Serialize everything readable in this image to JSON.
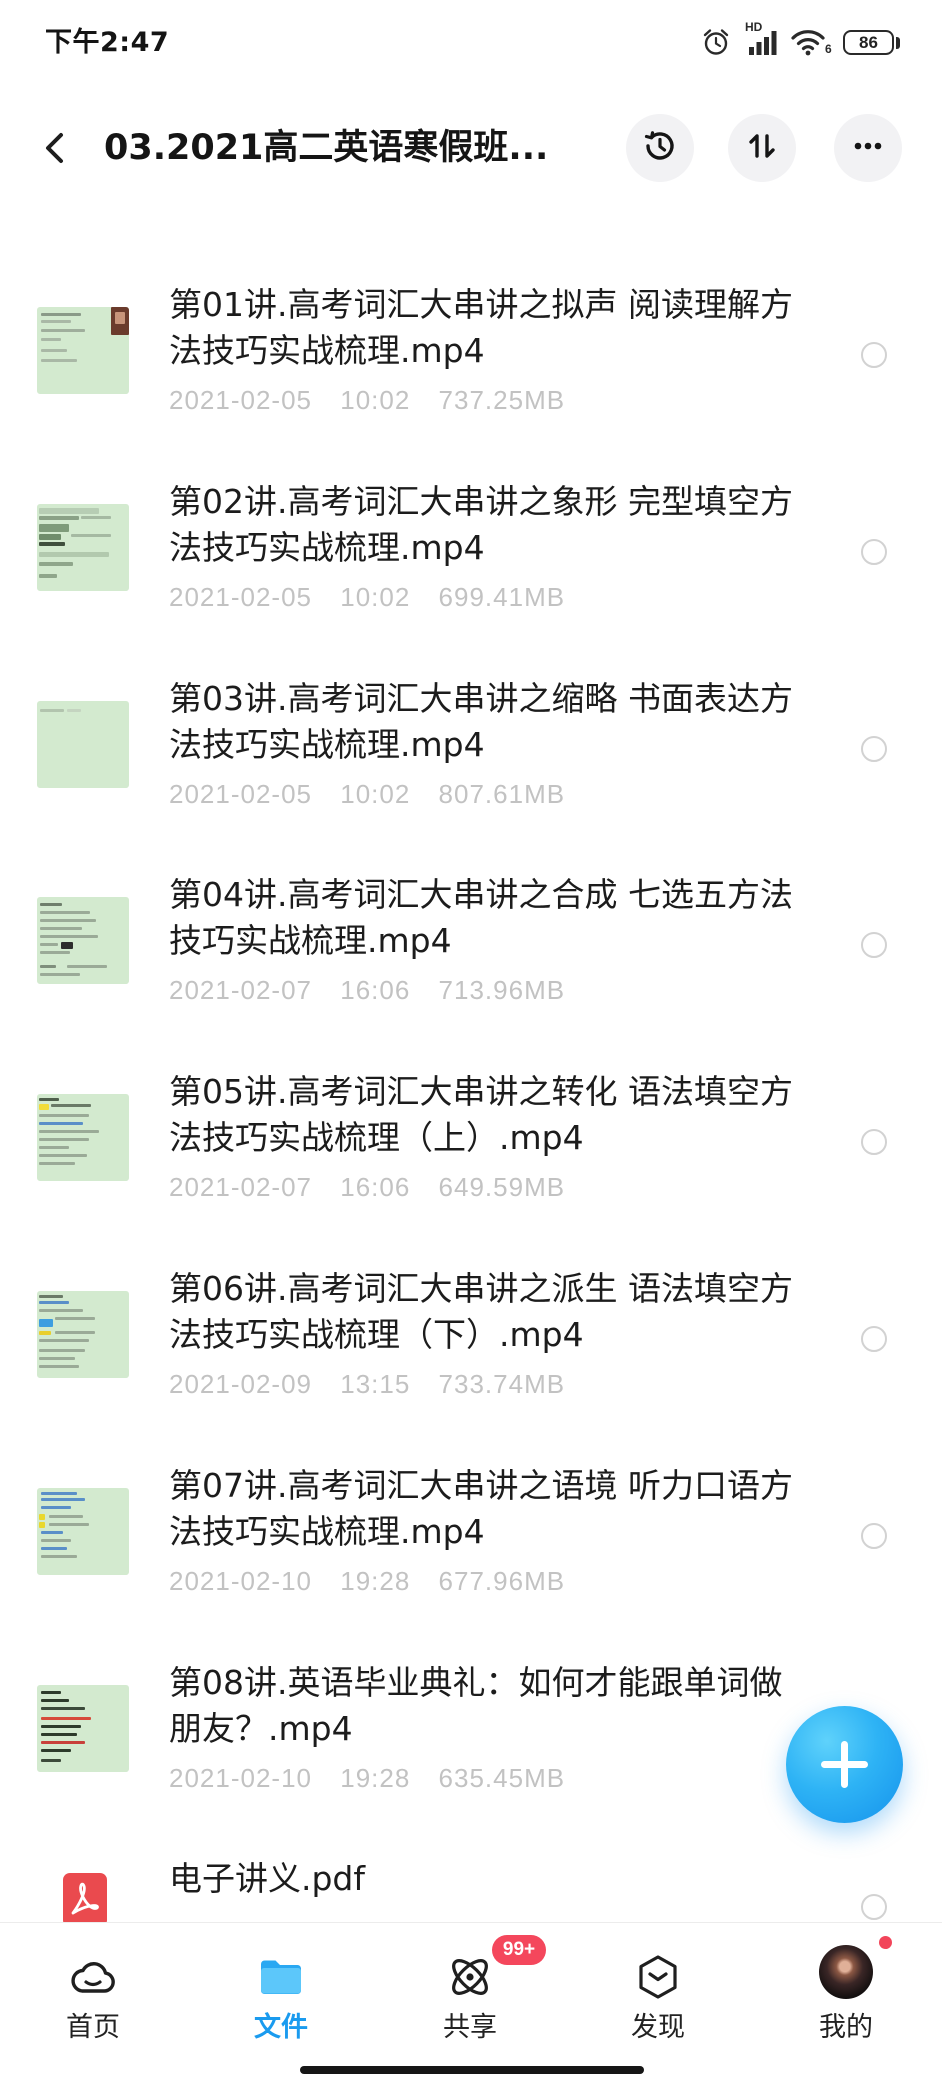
{
  "status_bar": {
    "time": "下午2:47",
    "network_label": "HD",
    "wifi_label": "6",
    "battery": "86",
    "icons": [
      "alarm-icon",
      "cellular-signal-icon",
      "wifi-icon",
      "battery-icon"
    ]
  },
  "header": {
    "title": "03.2021高二英语寒假班...",
    "icons": [
      "back-arrow-icon",
      "history-icon",
      "sort-icon",
      "more-icon"
    ]
  },
  "files": [
    {
      "name": "第01讲.高考词汇大串讲之拟声 阅读理解方法技巧实战梳理.mp4",
      "date": "2021-02-05",
      "time": "10:02",
      "size": "737.25MB",
      "type": "video"
    },
    {
      "name": "第02讲.高考词汇大串讲之象形 完型填空方法技巧实战梳理.mp4",
      "date": "2021-02-05",
      "time": "10:02",
      "size": "699.41MB",
      "type": "video"
    },
    {
      "name": "第03讲.高考词汇大串讲之缩略 书面表达方法技巧实战梳理.mp4",
      "date": "2021-02-05",
      "time": "10:02",
      "size": "807.61MB",
      "type": "video"
    },
    {
      "name": "第04讲.高考词汇大串讲之合成 七选五方法技巧实战梳理.mp4",
      "date": "2021-02-07",
      "time": "16:06",
      "size": "713.96MB",
      "type": "video"
    },
    {
      "name": "第05讲.高考词汇大串讲之转化 语法填空方法技巧实战梳理（上）.mp4",
      "date": "2021-02-07",
      "time": "16:06",
      "size": "649.59MB",
      "type": "video"
    },
    {
      "name": "第06讲.高考词汇大串讲之派生 语法填空方法技巧实战梳理（下）.mp4",
      "date": "2021-02-09",
      "time": "13:15",
      "size": "733.74MB",
      "type": "video"
    },
    {
      "name": "第07讲.高考词汇大串讲之语境 听力口语方法技巧实战梳理.mp4",
      "date": "2021-02-10",
      "time": "19:28",
      "size": "677.96MB",
      "type": "video"
    },
    {
      "name": "第08讲.英语毕业典礼：如何才能跟单词做朋友？.mp4",
      "date": "2021-02-10",
      "time": "19:28",
      "size": "635.45MB",
      "type": "video"
    },
    {
      "name": "电子讲义.pdf",
      "type": "pdf",
      "icon": "pdf-icon"
    }
  ],
  "fab": {
    "icon": "plus-icon"
  },
  "bottom_nav": {
    "items": [
      {
        "label": "首页",
        "icon": "home-cloud-icon",
        "active": false
      },
      {
        "label": "文件",
        "icon": "folder-icon",
        "active": true
      },
      {
        "label": "共享",
        "icon": "share-orbit-icon",
        "active": false,
        "badge": "99+"
      },
      {
        "label": "发现",
        "icon": "discover-icon",
        "active": false
      },
      {
        "label": "我的",
        "icon": "avatar",
        "active": false,
        "notification_dot": true
      }
    ]
  },
  "colors": {
    "accent": "#1a9bef",
    "badge": "#f4475c",
    "thumbnail": "#d3eacf",
    "meta_text": "#c2c2c2",
    "pdf": "#ea4a4e"
  }
}
